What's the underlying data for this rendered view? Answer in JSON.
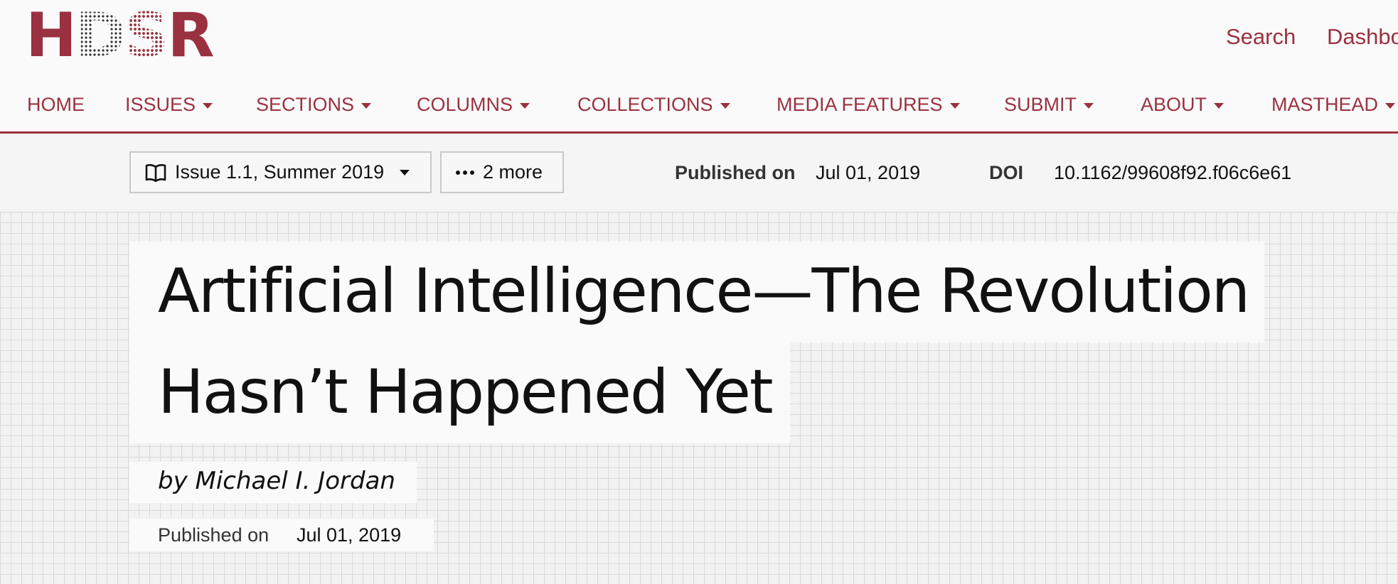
{
  "header": {
    "logo": [
      "H",
      "D",
      "S",
      "R"
    ],
    "links": {
      "search": "Search",
      "dashboard": "Dashbo"
    }
  },
  "nav": {
    "items": [
      {
        "label": "HOME",
        "has_dropdown": false
      },
      {
        "label": "ISSUES",
        "has_dropdown": true
      },
      {
        "label": "SECTIONS",
        "has_dropdown": true
      },
      {
        "label": "COLUMNS",
        "has_dropdown": true
      },
      {
        "label": "COLLECTIONS",
        "has_dropdown": true
      },
      {
        "label": "MEDIA FEATURES",
        "has_dropdown": true
      },
      {
        "label": "SUBMIT",
        "has_dropdown": true
      },
      {
        "label": "ABOUT",
        "has_dropdown": true
      },
      {
        "label": "MASTHEAD",
        "has_dropdown": true
      }
    ]
  },
  "meta": {
    "issue_label": "Issue 1.1, Summer 2019",
    "more_label": "2 more",
    "published_label": "Published on",
    "published_date": "Jul 01, 2019",
    "doi_label": "DOI",
    "doi_value": "10.1162/99608f92.f06c6e61"
  },
  "article": {
    "title_line1": "Artificial Intelligence—The Revolution",
    "title_line2": "Hasn’t Happened Yet",
    "byline": "by Michael I. Jordan",
    "published_label": "Published on",
    "published_date": "Jul 01, 2019"
  },
  "colors": {
    "brand": "#9a3140",
    "text": "#111111",
    "background": "#fafafa"
  },
  "icons": [
    "book-icon",
    "ellipsis-icon",
    "chevron-down-icon"
  ]
}
